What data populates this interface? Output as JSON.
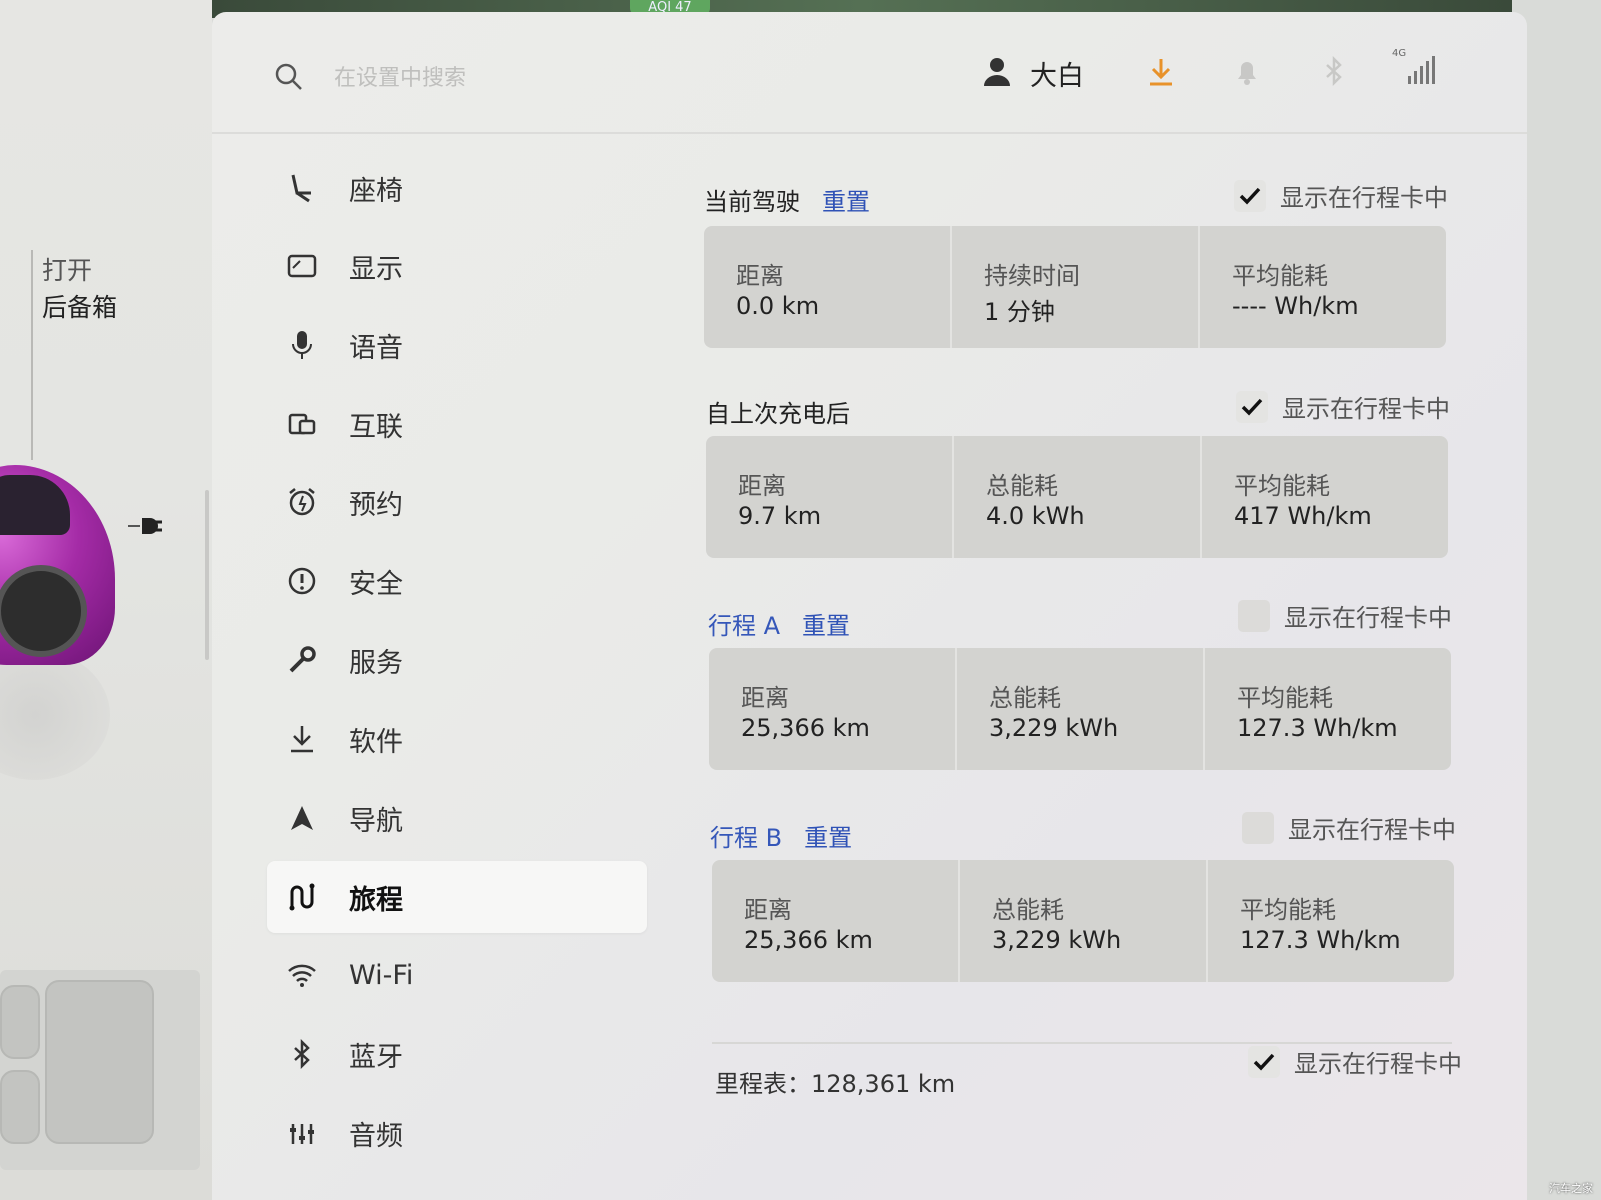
{
  "status": {
    "aqi": "AQI 47"
  },
  "left": {
    "trunk_line1": "打开",
    "trunk_line2": "后备箱"
  },
  "topbar": {
    "search_placeholder": "在设置中搜索",
    "user_name": "大白",
    "signal_label": "4G"
  },
  "nav": {
    "items": [
      {
        "label": "座椅",
        "icon": "seat-icon"
      },
      {
        "label": "显示",
        "icon": "display-icon"
      },
      {
        "label": "语音",
        "icon": "microphone-icon"
      },
      {
        "label": "互联",
        "icon": "connectivity-icon"
      },
      {
        "label": "预约",
        "icon": "alarm-clock-icon"
      },
      {
        "label": "安全",
        "icon": "alert-circle-icon"
      },
      {
        "label": "服务",
        "icon": "wrench-icon"
      },
      {
        "label": "软件",
        "icon": "download-icon"
      },
      {
        "label": "导航",
        "icon": "navigation-arrow-icon"
      },
      {
        "label": "旅程",
        "icon": "trip-icon",
        "active": true
      },
      {
        "label": "Wi-Fi",
        "icon": "wifi-icon"
      },
      {
        "label": "蓝牙",
        "icon": "bluetooth-icon"
      },
      {
        "label": "音频",
        "icon": "audio-sliders-icon"
      }
    ]
  },
  "trips": {
    "show_label": "显示在行程卡中",
    "reset_label": "重置",
    "current": {
      "title": "当前驾驶",
      "checked": true,
      "cells": [
        {
          "key": "距离",
          "value": "0.0  km"
        },
        {
          "key": "持续时间",
          "value": "1 分钟"
        },
        {
          "key": "平均能耗",
          "value": "----  Wh/km"
        }
      ]
    },
    "since_charge": {
      "title": "自上次充电后",
      "checked": true,
      "cells": [
        {
          "key": "距离",
          "value": "9.7  km"
        },
        {
          "key": "总能耗",
          "value": "4.0  kWh"
        },
        {
          "key": "平均能耗",
          "value": "417  Wh/km"
        }
      ]
    },
    "trip_a": {
      "title": "行程 A",
      "checked": false,
      "cells": [
        {
          "key": "距离",
          "value": "25,366  km"
        },
        {
          "key": "总能耗",
          "value": "3,229  kWh"
        },
        {
          "key": "平均能耗",
          "value": "127.3  Wh/km"
        }
      ]
    },
    "trip_b": {
      "title": "行程 B",
      "checked": false,
      "cells": [
        {
          "key": "距离",
          "value": "25,366  km"
        },
        {
          "key": "总能耗",
          "value": "3,229  kWh"
        },
        {
          "key": "平均能耗",
          "value": "127.3  Wh/km"
        }
      ]
    },
    "odometer": {
      "text": "里程表：128,361 km",
      "checked": true
    }
  },
  "watermark": "汽车之家",
  "colors": {
    "accent_blue": "#2f52b6",
    "download_orange": "#e8922a",
    "car_purple": "#a42ba6"
  }
}
